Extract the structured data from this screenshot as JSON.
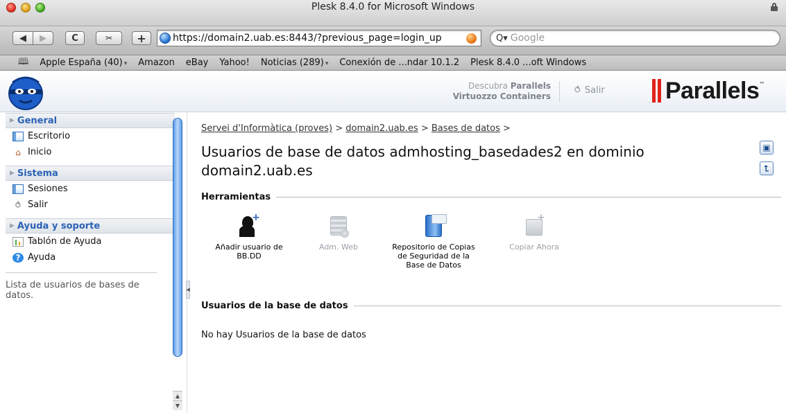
{
  "window": {
    "title": "Plesk 8.4.0 for Microsoft Windows"
  },
  "toolbar": {
    "back_label": "◀",
    "forward_label": "▶",
    "reload_label": "C",
    "snip_label": "✂",
    "add_label": "+",
    "url": "https://domain2.uab.es:8443/?previous_page=login_up",
    "search_placeholder": "Google",
    "search_prefix": "Q▾"
  },
  "bookmarks": [
    {
      "label": "Apple España (40)",
      "has_menu": true
    },
    {
      "label": "Amazon",
      "has_menu": false
    },
    {
      "label": "eBay",
      "has_menu": false
    },
    {
      "label": "Yahoo!",
      "has_menu": false
    },
    {
      "label": "Noticias (289)",
      "has_menu": true
    },
    {
      "label": "Conexión de ...ndar 10.1.2",
      "has_menu": false
    },
    {
      "label": "Plesk 8.4.0 ...oft Windows",
      "has_menu": false
    }
  ],
  "header": {
    "promo_line1": "Descubra ",
    "promo_line1_bold": "Parallels",
    "promo_line2": "Virtuozzo Containers",
    "logout_label": "Salir",
    "brand": "Parallels",
    "brand_color": "#e2231a"
  },
  "sidebar": {
    "general": {
      "title": "General",
      "items": [
        {
          "label": "Escritorio",
          "icon": "desktop-icon"
        },
        {
          "label": "Inicio",
          "icon": "home-icon"
        }
      ]
    },
    "sistema": {
      "title": "Sistema",
      "items": [
        {
          "label": "Sesiones",
          "icon": "sessions-icon"
        },
        {
          "label": "Salir",
          "icon": "logout-icon"
        }
      ]
    },
    "ayuda": {
      "title": "Ayuda y soporte",
      "items": [
        {
          "label": "Tablón de Ayuda",
          "icon": "help-desk-icon"
        },
        {
          "label": "Ayuda",
          "icon": "help-icon"
        }
      ]
    },
    "help_text": "Lista de usuarios de bases de datos."
  },
  "main": {
    "breadcrumb": [
      {
        "label": "Servei d'Informàtica (proves)",
        "link": true
      },
      {
        "label": "domain2.uab.es",
        "link": true
      },
      {
        "label": "Bases de datos",
        "link": true
      }
    ],
    "breadcrumb_sep": ">",
    "title": "Usuarios de base de datos admhosting_basedades2 en dominio domain2.uab.es",
    "tools_heading": "Herramientas",
    "tools": [
      {
        "label": "Añadir usuario de BB.DD",
        "icon": "add-user-icon",
        "enabled": true
      },
      {
        "label": "Adm. Web",
        "icon": "web-admin-icon",
        "enabled": false
      },
      {
        "label": "Repositorio de Copias de Seguridad de la Base de Datos",
        "icon": "backup-repository-icon",
        "enabled": true
      },
      {
        "label": "Copiar Ahora",
        "icon": "copy-now-icon",
        "enabled": false
      }
    ],
    "users_heading": "Usuarios de la base de datos",
    "no_data": "No hay Usuarios de la base de datos"
  }
}
